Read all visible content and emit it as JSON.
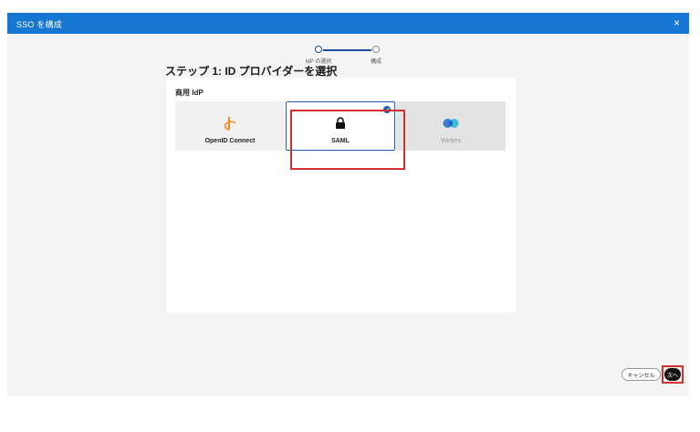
{
  "titlebar": {
    "title": "SSO を構成",
    "close_glyph": "×"
  },
  "stepper": {
    "steps": [
      {
        "label": "IdP の選択",
        "state": "active"
      },
      {
        "label": "構成",
        "state": "pending"
      }
    ]
  },
  "heading": "ステップ 1: ID プロバイダーを選択",
  "section": {
    "label": "商用 IdP"
  },
  "providers": [
    {
      "name": "OpenID Connect",
      "icon": "openid-icon",
      "selected": false,
      "enabled": true
    },
    {
      "name": "SAML",
      "icon": "lock-icon",
      "selected": true,
      "enabled": true
    },
    {
      "name": "Webex",
      "icon": "webex-icon",
      "selected": false,
      "enabled": false
    }
  ],
  "footer": {
    "cancel_label": "キャンセル",
    "next_label": "次へ"
  },
  "colors": {
    "titlebar": "#1677d2",
    "accent": "#1a5fb4",
    "openid": "#f28b20",
    "highlight": "#d32f2f"
  }
}
